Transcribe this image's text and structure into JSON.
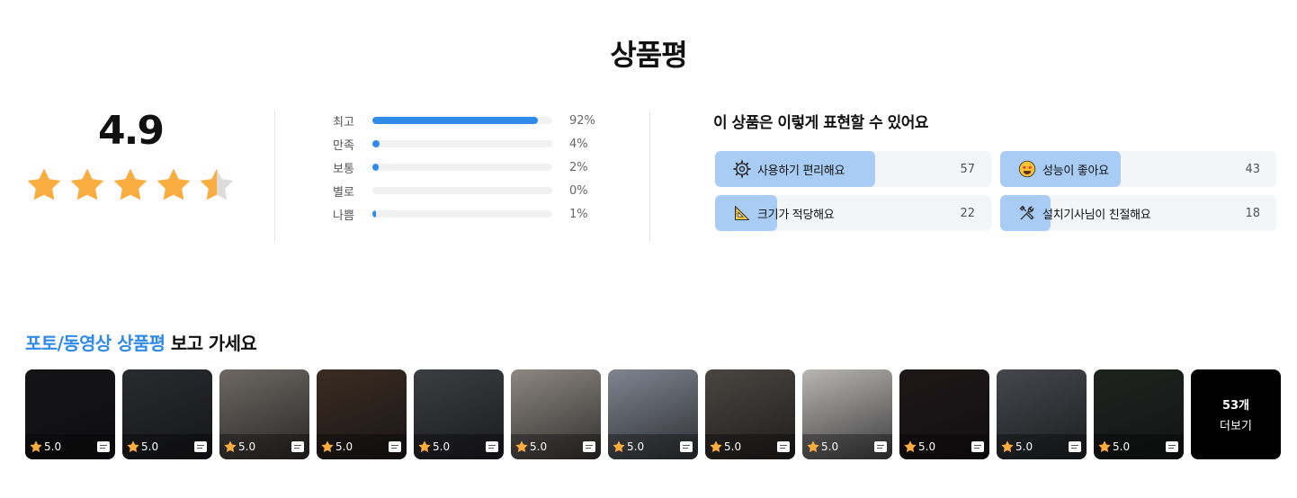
{
  "title": "상품평",
  "rating": {
    "score": "4.9",
    "stars_value": 4.5,
    "star_color": "#f9ac3f",
    "star_empty_color": "#dcdcdc"
  },
  "distribution": [
    {
      "label": "최고",
      "percent": "92%",
      "value": 92
    },
    {
      "label": "만족",
      "percent": "4%",
      "value": 4
    },
    {
      "label": "보통",
      "percent": "2%",
      "value": 2
    },
    {
      "label": "별로",
      "percent": "0%",
      "value": 0
    },
    {
      "label": "나쁨",
      "percent": "1%",
      "value": 1
    }
  ],
  "expressions": {
    "title": "이 상품은 이렇게 표현할 수 있어요",
    "items": [
      {
        "icon": "gear-icon",
        "label": "사용하기 편리해요",
        "count": "57",
        "value": 57
      },
      {
        "icon": "heart-eyes-icon",
        "label": "성능이 좋아요",
        "count": "43",
        "value": 43
      },
      {
        "icon": "ruler-icon",
        "label": "크기가 적당해요",
        "count": "22",
        "value": 22
      },
      {
        "icon": "tools-icon",
        "label": "설치기사님이 친절해요",
        "count": "18",
        "value": 18
      }
    ]
  },
  "photos": {
    "heading_highlight": "포토/동영상 상품평",
    "heading_rest": " 보고 가세요",
    "items": [
      {
        "rating": "5.0",
        "bg": "#141416"
      },
      {
        "rating": "5.0",
        "bg": "#2a2b2e"
      },
      {
        "rating": "5.0",
        "bg": "#6d6862"
      },
      {
        "rating": "5.0",
        "bg": "#3a2c22"
      },
      {
        "rating": "5.0",
        "bg": "#3c3d42"
      },
      {
        "rating": "5.0",
        "bg": "#8d8780"
      },
      {
        "rating": "5.0",
        "bg": "#7f8590"
      },
      {
        "rating": "5.0",
        "bg": "#4a4540"
      },
      {
        "rating": "5.0",
        "bg": "#b8b6b4"
      },
      {
        "rating": "5.0",
        "bg": "#1e1718"
      },
      {
        "rating": "5.0",
        "bg": "#44474d"
      },
      {
        "rating": "5.0",
        "bg": "#1f2420"
      }
    ],
    "more_count": "53개",
    "more_label": "더보기"
  }
}
